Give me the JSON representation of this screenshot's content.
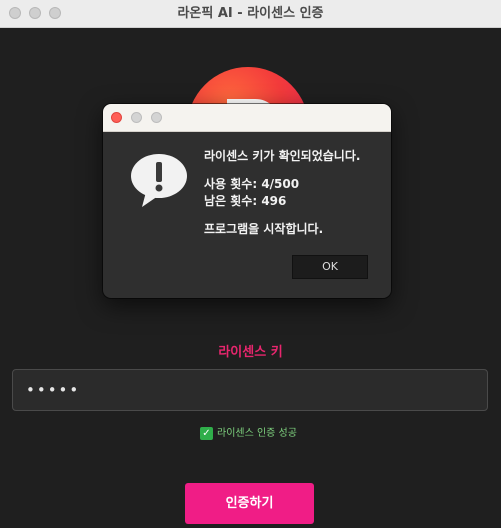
{
  "window": {
    "title": "라온픽 AI - 라이센스 인증"
  },
  "logo": {
    "icon": "raonpick-logo",
    "gradient": [
      "#ff6a3d",
      "#f33b3b",
      "#e01f5a"
    ]
  },
  "license": {
    "label": "라이센스 키",
    "value": "•••••",
    "label_color": "#e8266e"
  },
  "status": {
    "icon": "check-icon",
    "text": "라이센스 인증 성공",
    "color": "#7ed07e"
  },
  "auth_button": {
    "label": "인증하기",
    "color": "#f01d86"
  },
  "dialog": {
    "icon": "alert-bubble-icon",
    "line1": "라이센스 키가 확인되었습니다.",
    "line2": "사용 횟수: 4/500",
    "line3": "남은 횟수: 496",
    "line4": "프로그램을 시작합니다.",
    "ok_label": "OK"
  }
}
